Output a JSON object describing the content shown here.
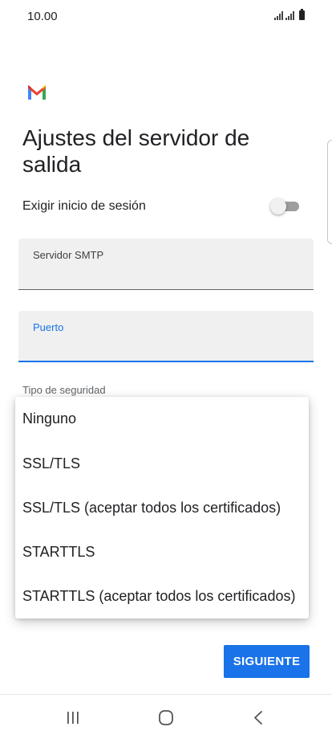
{
  "status_bar": {
    "time": "10.00"
  },
  "logo": {
    "icon": "gmail-logo-icon",
    "colors": {
      "red": "#ea4335",
      "blue": "#4285f4",
      "green": "#34a853",
      "yellow": "#fbbc04",
      "dark_red": "#c5221f"
    }
  },
  "page": {
    "title": "Ajustes del servidor de salida"
  },
  "require_login": {
    "label": "Exigir inicio de sesión",
    "enabled": false
  },
  "smtp_server": {
    "label": "Servidor SMTP",
    "value": ""
  },
  "port": {
    "label": "Puerto",
    "value": ""
  },
  "security": {
    "label": "Tipo de seguridad",
    "options": [
      "Ninguno",
      "SSL/TLS",
      "SSL/TLS (aceptar todos los certificados)",
      "STARTTLS",
      "STARTTLS (aceptar todos los certificados)"
    ]
  },
  "actions": {
    "next_label": "SIGUIENTE"
  },
  "colors": {
    "accent": "#1a73e8",
    "field_bg": "#f0f0f0",
    "text": "#202124"
  },
  "nav_bar": {
    "icons": [
      "recents-icon",
      "home-icon",
      "back-icon"
    ]
  }
}
